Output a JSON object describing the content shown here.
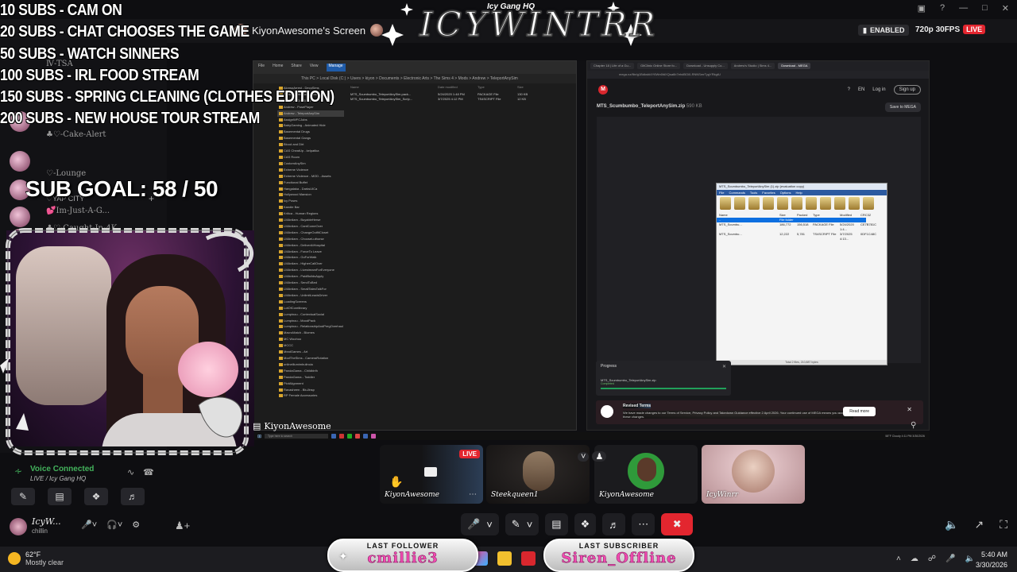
{
  "logo": {
    "title": "ICYWINTRR",
    "subtitle": "Icy Gang HQ"
  },
  "goals": [
    "10 SUBS - CAM ON",
    "20 SUBS - CHAT CHOOSES THE GAME",
    "50 SUBS - WATCH SINNERS",
    "100 SUBS - IRL FOOD STREAM",
    "150 SUBS - SPRING CLEANING (CLOTHES EDITION)",
    "200 SUBS - NEW HOUSE TOUR STREAM"
  ],
  "sub_goal": "SUB GOAL: 58 / 50",
  "header": {
    "screen_title": "KiyonAwesome's Screen",
    "enabled": "ENABLED",
    "quality": "720p 30FPS",
    "live": "LIVE"
  },
  "sidebar": {
    "channels": [
      {
        "label": "Ⅳ-TSA"
      },
      {
        "label": "♣♡-Cake-Alert"
      },
      {
        "label": "♡-Lounge"
      },
      {
        "label": "💕Im-Just-A-G..."
      },
      {
        "label": "♣♡-Caught-In-4K"
      }
    ],
    "category": "♡YAP CITY",
    "badge_count": "36"
  },
  "webcam": {
    "label": "KiyonAwesome"
  },
  "voice": {
    "status": "Voice Connected",
    "channel": "LIVE / Icy Gang HQ"
  },
  "user": {
    "name": "IcyW...",
    "status": "chillin"
  },
  "tiles": [
    {
      "name": "KiyonAwesome",
      "live": "LIVE"
    },
    {
      "name": "Steekqueen1"
    },
    {
      "name": "KiyonAwesome"
    },
    {
      "name": "IcyWinrr"
    }
  ],
  "explorer": {
    "ribbon": [
      "File",
      "Home",
      "Share",
      "View",
      "Manage"
    ],
    "ribbon_active": "Manage",
    "address": "This PC > Local Disk (C:) > Users > kiyon > Documents > Electronic Arts > The Sims 4 > Mods > Andrew > TeleportAnySim",
    "columns": [
      "Name",
      "Date modified",
      "Type",
      "Size"
    ],
    "files": [
      [
        "MTS_Scumbumbo_TeleportAnySim.pack...",
        "5/24/2020 1:48 PM",
        "PACKAGE File",
        "130 KB"
      ],
      [
        "MTS_Scumbumbo_TeleportAnySim_Scrip...",
        "3/7/2025 4:12 PM",
        "TS4SCRIPT File",
        "12 KB"
      ]
    ],
    "folders": [
      "AlonsoArrest - DecoSims",
      "AlonsoArrest(ActivityAsWit)",
      "Andrew - GenSimStore",
      "Andrew - PosePlayer",
      "Andrew - TeleportAnySim",
      "AssignWFCJobs",
      "BabyGaming - Animated Hide",
      "Basemental Drugs",
      "Basemental Gangs",
      "Blood and Dirt",
      "CAS CheatUp - kelpatika",
      "CAS Room",
      "CustomAnySim",
      "Extreme Violence",
      "Extreme Violence - MOD - Assets",
      "Functional Buffet",
      "Hangalaka - DarksUICa",
      "Hollywood Mansion",
      "Icy Poses",
      "Kandie Bar",
      "Kritica - Human Regions",
      "LMAnilam - BuyableHerse",
      "LMAnilam - CantComeOver",
      "LMAnilam - ChangeOutfitCloset",
      "LMAnilam - ChooseLuthorse",
      "LMAnilam - DeliverAtHospital",
      "LMAnilam - ForceTo Leave",
      "LMAnilam - GoForWalk",
      "LMAnilam - HigherCallOver",
      "LMAnilam - LivestreamForEveryone",
      "LMAnilam - PaidBuildsApply",
      "LMAnilam - SendToBed",
      "LMAnilam - SmallTalesTalkFor",
      "LMAnilam - UnlimitLeadsDriver",
      "LoadingScreens",
      "LotOfCorelibrary",
      "Lumpinou - ContextualSocial",
      "Lumpinou - MoodPack",
      "Lumpinou - RelationshipAndPregOverhaul",
      "MacroMatch - Biomes",
      "MC Woohoo",
      "MCCC",
      "MeatGames - Art",
      "ModTheSims - CameraRotation",
      "onlineillumimbulincia",
      "PandaGama - Childbirth",
      "PandaGama - Toddler",
      "PlotAlignment",
      "Ravasheen - BluJinsp",
      "RP Female Accessories"
    ],
    "selected_folder": "Andrew - TeleportAnySim"
  },
  "mega": {
    "tabs": [
      "Chapter 18 | Life of a Gu...",
      "GitClinic Online Store fo...",
      "Download - Unsupply Co...",
      "Andrew's Studio | Sims 4...",
      "Download - MEGA"
    ],
    "active_tab": "Download - MEGA",
    "url": "mega.nz/file/g1Bdkst#4Y6Wn6fdXQsa6b7ehdBOi0-RNNSmrTygYRkgtU",
    "lang": "EN",
    "login": "Log in",
    "signup": "Sign up",
    "file_name": "MTS_Scumbumbo_TeleportAnySim.zip",
    "file_size": "590 KB",
    "save_btn": "Save to MEGA",
    "progress_title": "Progress",
    "progress_file": "MTS_Scumbumbo_TeleportAnySim.zip",
    "progress_status": "Completed",
    "progress_fraction": 1.0,
    "terms_title": "Revised Terms",
    "terms_text": "We have made changes to our Terms of Service, Privacy Policy and Takedown Guidance effective 2 April 2026. Your continued use of MEGA means you accept these changes.",
    "terms_button": "Read more"
  },
  "winrar": {
    "title": "MTS_Scumbumbo_TeleportAnySim (1).zip (evaluation copy)",
    "menu": [
      "File",
      "Commands",
      "Tools",
      "Favorites",
      "Options",
      "Help"
    ],
    "columns": [
      "Name",
      "Size",
      "Packed",
      "Type",
      "Modified",
      "CRC32"
    ],
    "rows": [
      [
        "..",
        "",
        "",
        "File folder",
        "",
        ""
      ],
      [
        "MTS_Scumbu...",
        "186,772",
        "156,518",
        "PACKAGE File",
        "5/24/2020 1:4...",
        "CE7B781C"
      ],
      [
        "MTS_Scumbu...",
        "12,222",
        "5,781",
        "TS4SCRIPT File",
        "3/7/2025 4:13...",
        "0DF1C48C"
      ]
    ],
    "status": "Total 2 files, 210,887 bytes"
  },
  "inner_taskbar": {
    "search": "Type here to search",
    "tray": "58°F Cloudy  4:11 PM 3/30/2026"
  },
  "followers": {
    "last_follower_label": "LAST FOLLOWER",
    "last_follower": "cmillie3",
    "last_subscriber_label": "LAST SUBSCRIBER",
    "last_subscriber": "Siren_Offline"
  },
  "weather": {
    "temp": "62°F",
    "desc": "Mostly clear"
  },
  "clock": {
    "time": "5:40 AM",
    "date": "3/30/2026"
  }
}
